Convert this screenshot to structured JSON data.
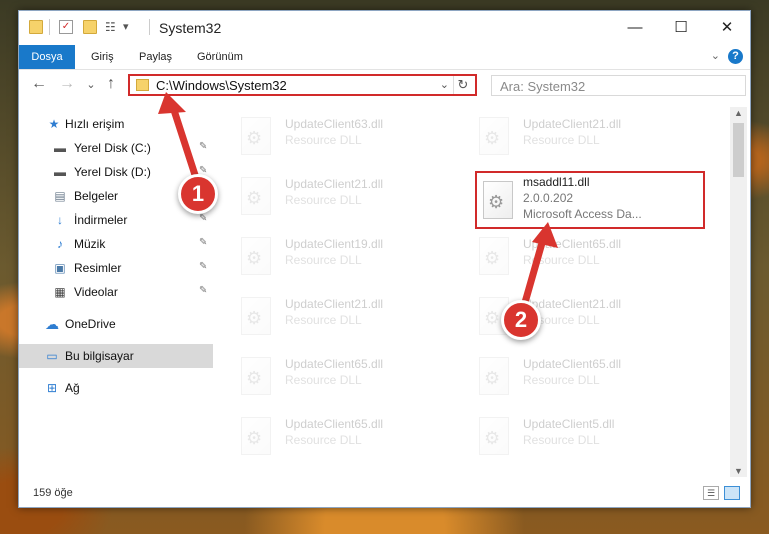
{
  "window": {
    "title": "System32",
    "quick_access_toggle": "▾",
    "minimize": "—",
    "maximize": "☐",
    "close": "✕"
  },
  "ribbon": {
    "tabs": [
      "Dosya",
      "Giriş",
      "Paylaş",
      "Görünüm"
    ],
    "help": "?",
    "expand": "⌄"
  },
  "nav": {
    "back": "←",
    "forward": "→",
    "recent": "⌄",
    "up": "↑",
    "address_path": "C:\\Windows\\System32",
    "address_dropdown": "⌄",
    "refresh": "↻",
    "search_placeholder": "Ara: System32"
  },
  "sidebar": {
    "items": [
      {
        "label": "Hızlı erişim",
        "icon": "star-icon",
        "glyph": "★",
        "color": "#2e7dd1",
        "pinned": false
      },
      {
        "label": "Yerel Disk (C:)",
        "icon": "drive-icon",
        "glyph": "▬",
        "color": "#555555",
        "pinned": true
      },
      {
        "label": "Yerel Disk (D:)",
        "icon": "drive-icon",
        "glyph": "▬",
        "color": "#555555",
        "pinned": true
      },
      {
        "label": "Belgeler",
        "icon": "documents-icon",
        "glyph": "▤",
        "color": "#6b7b8c",
        "pinned": true
      },
      {
        "label": "İndirmeler",
        "icon": "download-icon",
        "glyph": "↓",
        "color": "#2e7dd1",
        "pinned": true
      },
      {
        "label": "Müzik",
        "icon": "music-icon",
        "glyph": "♪",
        "color": "#2e7dd1",
        "pinned": true
      },
      {
        "label": "Resimler",
        "icon": "pictures-icon",
        "glyph": "▣",
        "color": "#4a7aa8",
        "pinned": true
      },
      {
        "label": "Videolar",
        "icon": "videos-icon",
        "glyph": "▦",
        "color": "#444444",
        "pinned": true
      },
      {
        "label": "OneDrive",
        "icon": "cloud-icon",
        "glyph": "☁",
        "color": "#2e7dd1",
        "pinned": false
      },
      {
        "label": "Bu bilgisayar",
        "icon": "computer-icon",
        "glyph": "▭",
        "color": "#2e7dd1",
        "pinned": false
      },
      {
        "label": "Ağ",
        "icon": "network-icon",
        "glyph": "⊞",
        "color": "#2e7dd1",
        "pinned": false
      }
    ],
    "pin_glyph": "📌"
  },
  "files": {
    "left_column": [
      {
        "name": "UpdateClient63.dll",
        "desc": "Resource DLL"
      },
      {
        "name": "UpdateClient21.dll",
        "desc": "Resource DLL"
      },
      {
        "name": "UpdateClient19.dll",
        "desc": "Resource DLL"
      },
      {
        "name": "UpdateClient21.dll",
        "desc": "Resource DLL"
      },
      {
        "name": "UpdateClient65.dll",
        "desc": "Resource DLL"
      },
      {
        "name": "UpdateClient65.dll",
        "desc": "Resource DLL"
      }
    ],
    "right_column": [
      {
        "name": "UpdateClient21.dll",
        "desc": "Resource DLL"
      },
      {
        "name": "UpdateClient65.dll",
        "desc": "Resource DLL"
      },
      {
        "name": "UpdateClient21.dll",
        "desc": "Resource DLL"
      },
      {
        "name": "UpdateClient65.dll",
        "desc": "Resource DLL"
      },
      {
        "name": "UpdateClient5.dll",
        "desc": "Resource DLL"
      }
    ],
    "highlighted": {
      "name": "msaddl11.dll",
      "version": "2.0.0.202",
      "desc": "Microsoft Access Da..."
    }
  },
  "status": {
    "item_count": "159 öğe"
  },
  "annotations": {
    "badge1": "1",
    "badge2": "2",
    "color": "#d9352f"
  }
}
